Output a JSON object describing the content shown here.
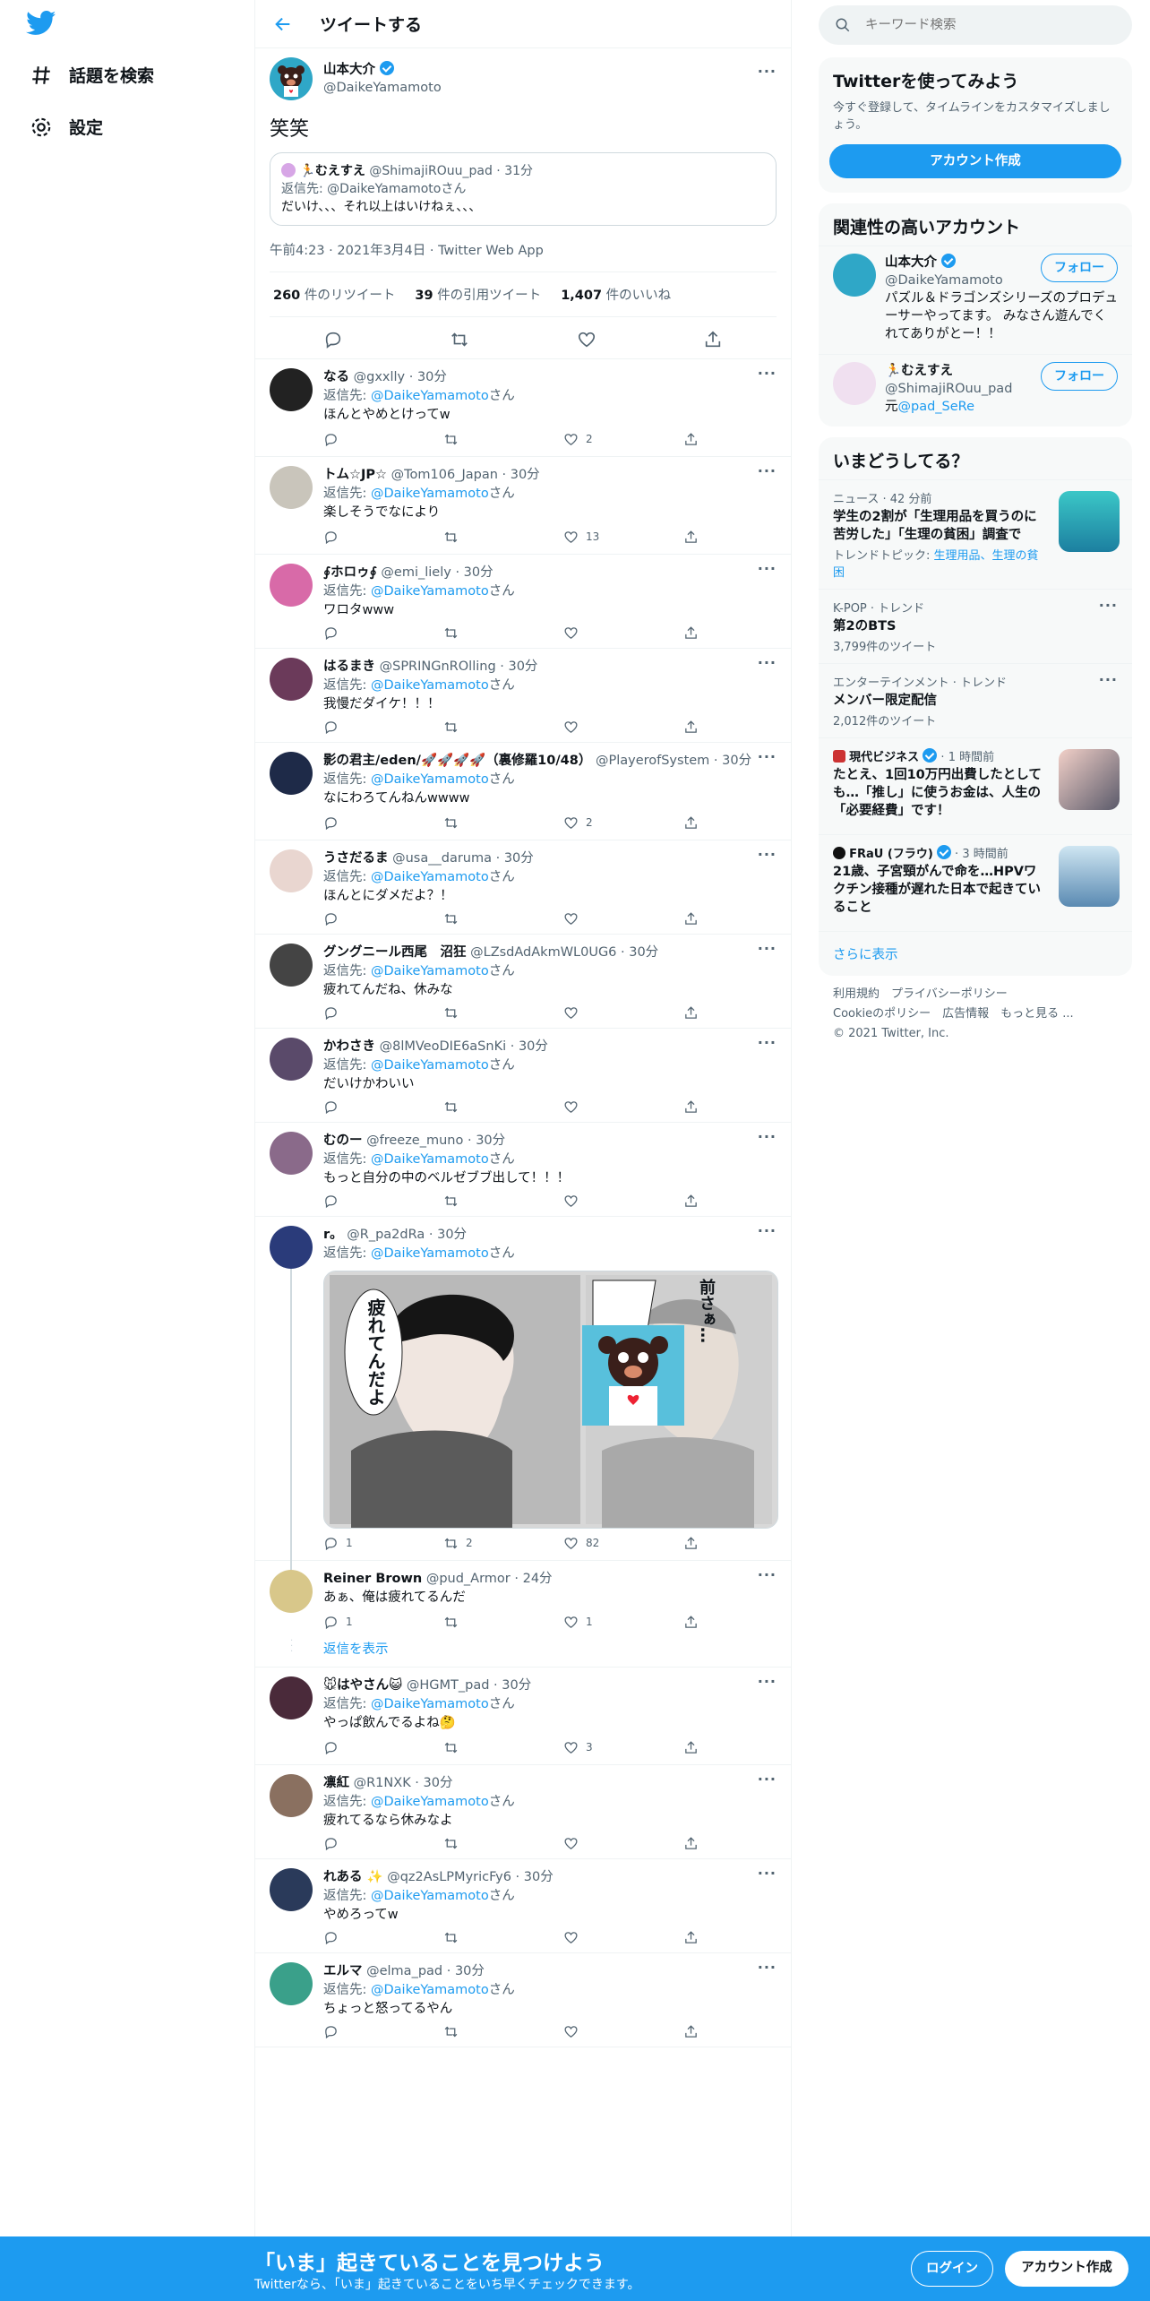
{
  "nav": {
    "explore": "話題を検索",
    "settings": "設定"
  },
  "header": {
    "title": "ツイートする"
  },
  "main_tweet": {
    "name": "山本大介",
    "handle": "@DaikeYamamoto",
    "text": "笑笑",
    "quote": {
      "name": "むえすえ",
      "handle": "@ShimajiROuu_pad",
      "time": "31分",
      "reply_prefix": "返信先: ",
      "reply_to": "@DaikeYamamoto",
      "reply_suffix": "さん",
      "text": "だいけ、、、それ以上はいけねぇ、、、"
    },
    "meta": "午前4:23 · 2021年3月4日 · Twitter Web App",
    "retweets": "260",
    "retweets_label": "件のリツイート",
    "quotes": "39",
    "quotes_label": "件の引用ツイート",
    "likes": "1,407",
    "likes_label": "件のいいね"
  },
  "reply_prefix": "返信先: ",
  "reply_to": "@DaikeYamamoto",
  "reply_suffix": "さん",
  "dots": "···",
  "replies": [
    {
      "name": "なる",
      "handle": "@gxxlly",
      "time": "30分",
      "text": "ほんとやめとけってw",
      "replies": "",
      "rts": "",
      "likes": "2",
      "color": "#222222"
    },
    {
      "name": "トム☆JP☆",
      "handle": "@Tom106_Japan",
      "time": "30分",
      "text": "楽しそうでなにより",
      "replies": "",
      "rts": "",
      "likes": "13",
      "color": "#c9c5bb"
    },
    {
      "name": "∮ホロゥ∮",
      "handle": "@emi_liely",
      "time": "30分",
      "text": "ワロタwww",
      "replies": "",
      "rts": "",
      "likes": "",
      "color": "#d86aa8"
    },
    {
      "name": "はるまき",
      "handle": "@SPRINGnROlling",
      "time": "30分",
      "text": "我慢だダイケ！！！",
      "replies": "",
      "rts": "",
      "likes": "",
      "color": "#6b3a5a"
    },
    {
      "name": "影の君主/eden/🚀🚀🚀🚀（裏修羅10/48）",
      "handle": "@PlayerofSystem",
      "time": "30分",
      "text": "なにわろてんねんwwww",
      "replies": "",
      "rts": "",
      "likes": "2",
      "color": "#1e2a48"
    },
    {
      "name": "うさだるま",
      "handle": "@usa__daruma",
      "time": "30分",
      "text": "ほんとにダメだよ？！",
      "replies": "",
      "rts": "",
      "likes": "",
      "color": "#e9d6d0"
    },
    {
      "name": "グングニール西尾　沼狂",
      "handle": "@LZsdAdAkmWL0UG6",
      "time": "30分",
      "text": "疲れてんだね、休みな",
      "replies": "",
      "rts": "",
      "likes": "",
      "color": "#444444"
    },
    {
      "name": "かわさき",
      "handle": "@8lMVeoDIE6aSnKi",
      "time": "30分",
      "text": "だいけかわいい",
      "replies": "",
      "rts": "",
      "likes": "",
      "color": "#5a4a6a"
    },
    {
      "name": "むのー",
      "handle": "@freeze_muno",
      "time": "30分",
      "text": "もっと自分の中のベルゼブブ出して！！！",
      "replies": "",
      "rts": "",
      "likes": "",
      "color": "#8a6a8a"
    }
  ],
  "image_reply": {
    "name": "r。",
    "handle": "@R_pa2dRa",
    "time": "30分",
    "replies": "1",
    "rts": "2",
    "likes": "82",
    "manga_text1": "疲れてんだよ",
    "manga_text2": "前さぁ…"
  },
  "thread_reply": {
    "name": "Reiner Brown",
    "handle": "@pud_Armor",
    "time": "24分",
    "text": "あぁ、俺は疲れてるんだ",
    "replies": "1",
    "rts": "",
    "likes": "1",
    "show_replies": "返信を表示"
  },
  "replies2": [
    {
      "name": "🐭はやさん😺",
      "handle": "@HGMT_pad",
      "time": "30分",
      "text": "やっぱ飲んでるよね🤔",
      "replies": "",
      "rts": "",
      "likes": "3",
      "color": "#4a2a3a"
    },
    {
      "name": "凛紅",
      "handle": "@R1NXK",
      "time": "30分",
      "text": "疲れてるなら休みなよ",
      "replies": "",
      "rts": "",
      "likes": "",
      "color": "#8a7060"
    },
    {
      "name": "れある ✨",
      "handle": "@qz2AsLPMyricFy6",
      "time": "30分",
      "text": "やめろってw",
      "replies": "",
      "rts": "",
      "likes": "",
      "color": "#2a3a5a"
    },
    {
      "name": "エルマ",
      "handle": "@elma_pad",
      "time": "30分",
      "text": "ちょっと怒ってるやん",
      "replies": "",
      "rts": "",
      "likes": "",
      "color": "#3aa08a"
    }
  ],
  "search": {
    "placeholder": "キーワード検索"
  },
  "signup": {
    "title": "Twitterを使ってみよう",
    "desc": "今すぐ登録して、タイムラインをカスタマイズしましょう。",
    "button": "アカウント作成"
  },
  "related": {
    "title": "関連性の高いアカウント",
    "follow": "フォロー",
    "accounts": [
      {
        "name": "山本大介",
        "handle": "@DaikeYamamoto",
        "bio": "パズル＆ドラゴンズシリーズのプロデューサーやってます。 みなさん遊んでくれてありがとー！！"
      },
      {
        "name": "むえすえ",
        "handle": "@ShimajiROuu_pad",
        "bio_prefix": "元",
        "bio_link": "@pad_SeRe"
      }
    ]
  },
  "trends": {
    "title": "いまどうしてる？",
    "more": "さらに表示",
    "items": [
      {
        "meta": "ニュース · 42 分前",
        "title": "学生の2割が「生理用品を買うのに苦労した」「生理の貧困」調査で",
        "topic_prefix": "トレンドトピック: ",
        "topic": "生理用品、生理の貧困"
      },
      {
        "meta": "K-POP · トレンド",
        "title": "第2のBTS",
        "count": "3,799件のツイート"
      },
      {
        "meta": "エンターテインメント · トレンド",
        "title": "メンバー限定配信",
        "count": "2,012件のツイート"
      },
      {
        "source": "現代ビジネス",
        "time": "1 時間前",
        "title": "たとえ、1回10万円出費したとしても…「推し」に使うお金は、人生の「必要経費」です！"
      },
      {
        "source": "FRaU (フラウ)",
        "time": "3 時間前",
        "title": "21歳、子宮頸がんで命を…HPVワクチン接種が遅れた日本で起きていること"
      }
    ]
  },
  "footer": {
    "l1": "利用規約　プライバシーポリシー",
    "l2": "Cookieのポリシー　広告情報　もっと見る ...",
    "l3": "© 2021 Twitter, Inc."
  },
  "bottom": {
    "title": "「いま」起きていることを見つけよう",
    "sub": "Twitterなら、「いま」起きていることをいち早くチェックできます。",
    "login": "ログイン",
    "signup": "アカウント作成"
  }
}
